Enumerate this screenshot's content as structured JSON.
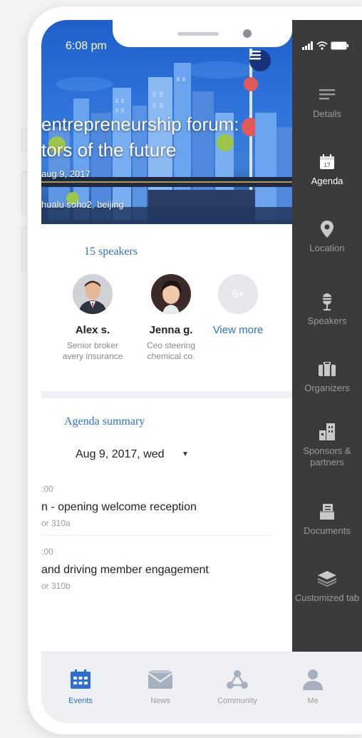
{
  "status": {
    "time": "6:08 pm"
  },
  "event": {
    "title_line1": "entrepreneurship forum:",
    "title_line2": "tors of the future",
    "date": "aug 9, 2017",
    "location": "hualu soho2, beijing"
  },
  "speakers": {
    "count_label": "15 speakers",
    "items": [
      {
        "name": "Alex s.",
        "role": "Senior broker avery insurance"
      },
      {
        "name": "Jenna g.",
        "role": "Ceo steering chemical co."
      }
    ],
    "more_badge": "5+",
    "view_more": "View more"
  },
  "agenda": {
    "section_title": "Agenda summary",
    "selected_date": "Aug 9, 2017, wed",
    "items": [
      {
        "time": ":00",
        "title": "n - opening welcome reception",
        "room": "or 310a"
      },
      {
        "time": ":00",
        "title": "and driving member engagement",
        "room": "or 310b"
      }
    ]
  },
  "sidebar": {
    "items": [
      {
        "label": "Details",
        "icon": "details-icon"
      },
      {
        "label": "Agenda",
        "icon": "calendar-icon",
        "badge": "17"
      },
      {
        "label": "Location",
        "icon": "location-pin-icon"
      },
      {
        "label": "Speakers",
        "icon": "microphone-icon"
      },
      {
        "label": "Organizers",
        "icon": "briefcase-icon"
      },
      {
        "label": "Sponsors & partners",
        "icon": "buildings-icon"
      },
      {
        "label": "Documents",
        "icon": "documents-icon"
      },
      {
        "label": "Customized tab",
        "icon": "layers-icon"
      }
    ],
    "active": "Agenda"
  },
  "tabs": [
    {
      "label": "Events",
      "icon": "calendar-grid-icon"
    },
    {
      "label": "News",
      "icon": "mail-icon"
    },
    {
      "label": "Community",
      "icon": "network-icon"
    },
    {
      "label": "Me",
      "icon": "person-icon"
    }
  ],
  "active_tab": "Events",
  "colors": {
    "accent": "#2a6fd1",
    "sidebar_bg": "#3b3b3c",
    "tabbar_bg": "#eef0f3"
  }
}
